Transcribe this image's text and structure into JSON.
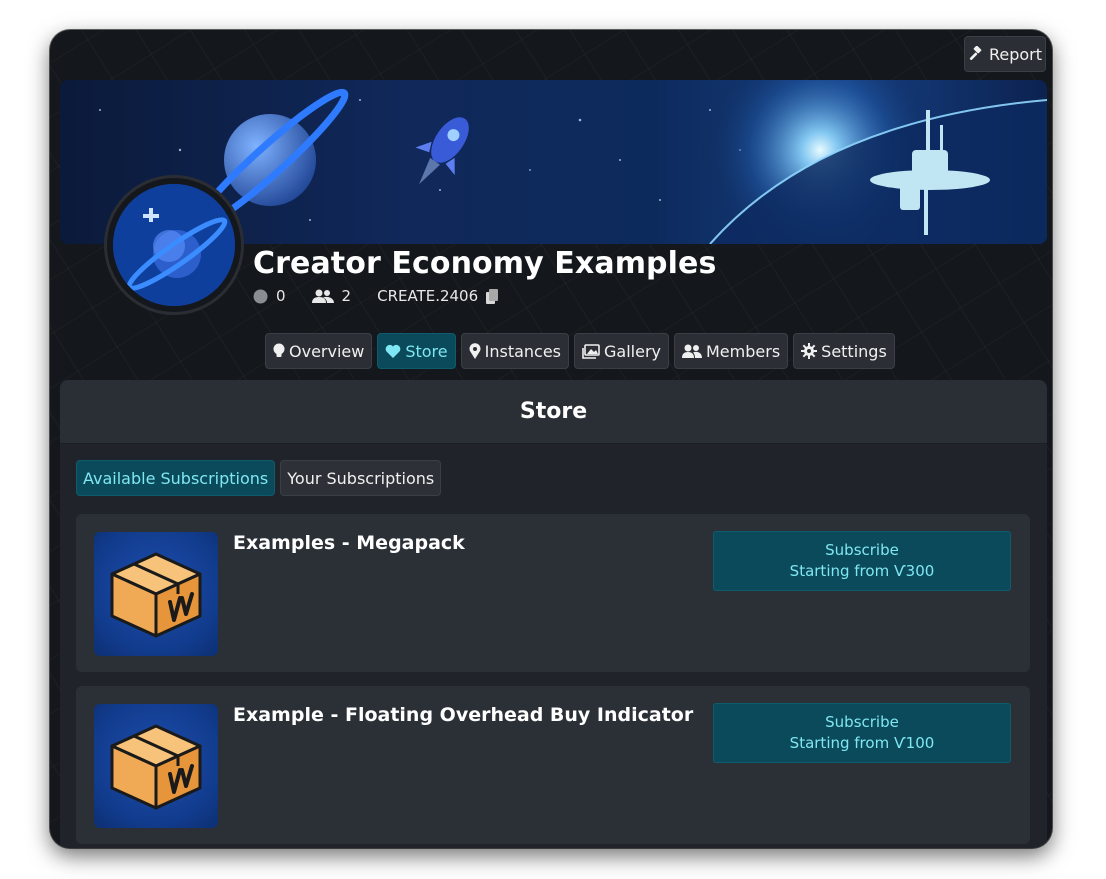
{
  "header": {
    "report_label": "Report"
  },
  "group": {
    "title": "Creator Economy Examples",
    "online_count": "0",
    "member_count": "2",
    "short_code": "CREATE.2406"
  },
  "tabs": [
    {
      "label": "Overview",
      "icon": "lightbulb-icon"
    },
    {
      "label": "Store",
      "icon": "heart-icon",
      "active": true
    },
    {
      "label": "Instances",
      "icon": "map-pin-icon"
    },
    {
      "label": "Gallery",
      "icon": "images-icon"
    },
    {
      "label": "Members",
      "icon": "users-icon"
    },
    {
      "label": "Settings",
      "icon": "gear-icon"
    }
  ],
  "store": {
    "heading": "Store",
    "subtabs": [
      {
        "label": "Available Subscriptions",
        "active": true
      },
      {
        "label": "Your Subscriptions",
        "active": false
      }
    ],
    "items": [
      {
        "title": "Examples - Megapack",
        "button_line1": "Subscribe",
        "button_line2": "Starting from Ѵ300"
      },
      {
        "title": "Example - Floating Overhead Buy Indicator",
        "button_line1": "Subscribe",
        "button_line2": "Starting from Ѵ100"
      }
    ]
  },
  "colors": {
    "accent": "#7fe6f3",
    "accent_bg": "#0b4a5a",
    "panel": "#20242a",
    "card": "#2b3037"
  }
}
